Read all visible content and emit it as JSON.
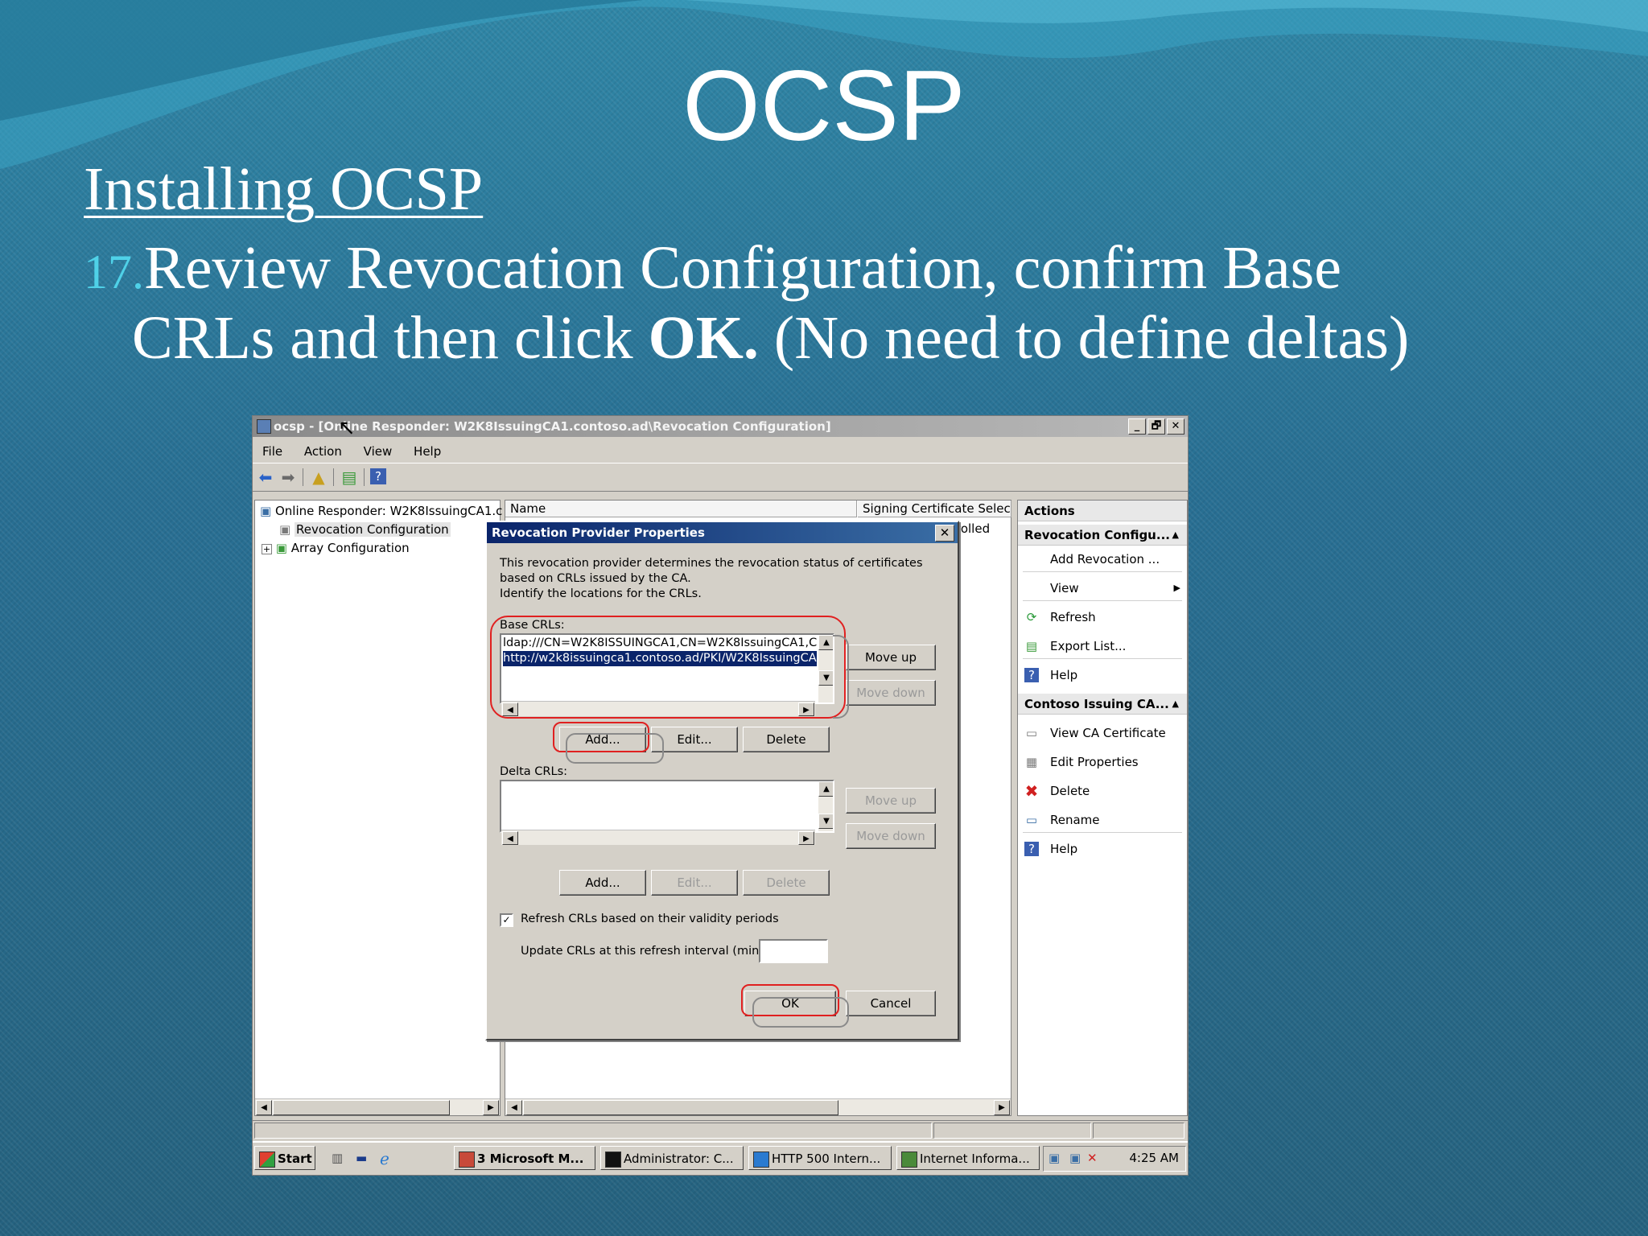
{
  "slide": {
    "title": "OCSP",
    "subtitle": "Installing OCSP",
    "step_number": "17.",
    "step_line1": "Review Revocation Configuration, confirm Base",
    "step_line2_a": "CRLs and then click ",
    "step_line2_bold": "OK.",
    "step_line2_b": " (No need to define deltas)"
  },
  "window": {
    "title": "ocsp - [Online Responder: W2K8IssuingCA1.contoso.ad\\Revocation Configuration]",
    "controls": [
      "_",
      "🗗",
      "✕"
    ],
    "menu": [
      "File",
      "Action",
      "View",
      "Help"
    ]
  },
  "tree": {
    "items": [
      "Online Responder: W2K8IssuingCA1.c",
      "Revocation Configuration",
      "Array Configuration"
    ],
    "expander": "+"
  },
  "center": {
    "columns": [
      "Name",
      "Signing Certificate Selectio"
    ],
    "cell_fragment": "rolled"
  },
  "actions": {
    "header": "Actions",
    "sections": [
      {
        "title": "Revocation Configu...",
        "items": [
          "Add Revocation ...",
          "View",
          "Refresh",
          "Export List...",
          "Help"
        ]
      },
      {
        "title": "Contoso Issuing CA...",
        "items": [
          "View CA Certificate",
          "Edit Properties",
          "Delete",
          "Rename",
          "Help"
        ]
      }
    ]
  },
  "dialog": {
    "title": "Revocation Provider Properties",
    "close": "✕",
    "description": [
      "This revocation provider determines the revocation status of certificates",
      "based on CRLs issued by the CA.",
      "Identify the locations for the CRLs."
    ],
    "base_label": "Base CRLs:",
    "base_items": [
      "ldap:///CN=W2K8ISSUINGCA1,CN=W2K8IssuingCA1,C",
      "http://w2k8issuingca1.contoso.ad/PKI/W2K8IssuingCA"
    ],
    "delta_label": "Delta CRLs:",
    "buttons": {
      "move_up": "Move up",
      "move_down": "Move down",
      "add": "Add...",
      "edit": "Edit...",
      "delete": "Delete",
      "ok": "OK",
      "cancel": "Cancel"
    },
    "refresh_label": "Refresh CRLs based on their validity periods",
    "refresh_checked": true,
    "interval_label": "Update CRLs at this refresh interval (min):",
    "interval_value": ""
  },
  "taskbar": {
    "start": "Start",
    "buttons": [
      "3 Microsoft M...",
      "Administrator: C...",
      "HTTP 500 Intern...",
      "Internet Informa..."
    ],
    "time": "4:25 AM"
  },
  "colors": {
    "highlight": "#0a246a",
    "annotation": "#e02020",
    "step_number": "#4fd1e8"
  }
}
